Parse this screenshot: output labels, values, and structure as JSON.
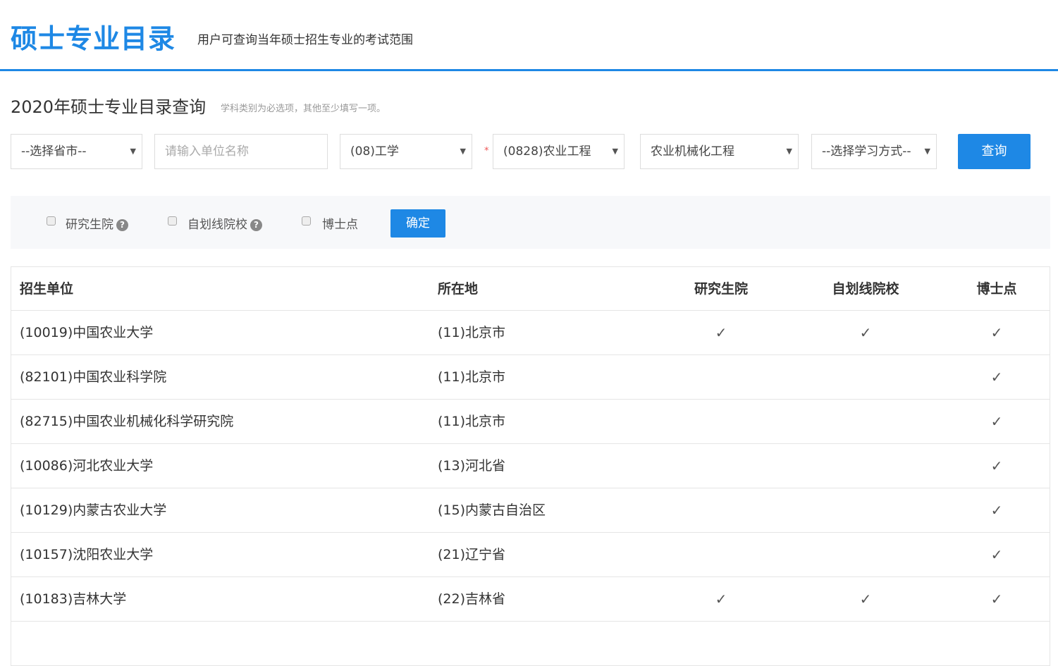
{
  "header": {
    "logo": "硕士专业目录",
    "subtitle": "用户可查询当年硕士招生专业的考试范围"
  },
  "query": {
    "title": "2020年硕士专业目录查询",
    "hint": "学科类别为必选项，其他至少填写一项。",
    "province": "--选择省市--",
    "unit_placeholder": "请输入单位名称",
    "category": "(08)工学",
    "required_mark": "*",
    "discipline": "(0828)农业工程",
    "major": "农业机械化工程",
    "study_mode": "--选择学习方式--",
    "search_label": "查询"
  },
  "filters": {
    "graduate_school": "研究生院",
    "self_line": "自划线院校",
    "doctoral": "博士点",
    "help": "?",
    "confirm_label": "确定"
  },
  "table": {
    "headers": [
      "招生单位",
      "所在地",
      "研究生院",
      "自划线院校",
      "博士点"
    ],
    "check": "✓",
    "rows": [
      {
        "unit": "(10019)中国农业大学",
        "location": "(11)北京市",
        "grad": true,
        "self": true,
        "doc": true
      },
      {
        "unit": "(82101)中国农业科学院",
        "location": "(11)北京市",
        "grad": false,
        "self": false,
        "doc": true
      },
      {
        "unit": "(82715)中国农业机械化科学研究院",
        "location": "(11)北京市",
        "grad": false,
        "self": false,
        "doc": true
      },
      {
        "unit": "(10086)河北农业大学",
        "location": "(13)河北省",
        "grad": false,
        "self": false,
        "doc": true
      },
      {
        "unit": "(10129)内蒙古农业大学",
        "location": "(15)内蒙古自治区",
        "grad": false,
        "self": false,
        "doc": true
      },
      {
        "unit": "(10157)沈阳农业大学",
        "location": "(21)辽宁省",
        "grad": false,
        "self": false,
        "doc": true
      },
      {
        "unit": "(10183)吉林大学",
        "location": "(22)吉林省",
        "grad": true,
        "self": true,
        "doc": true
      }
    ]
  }
}
